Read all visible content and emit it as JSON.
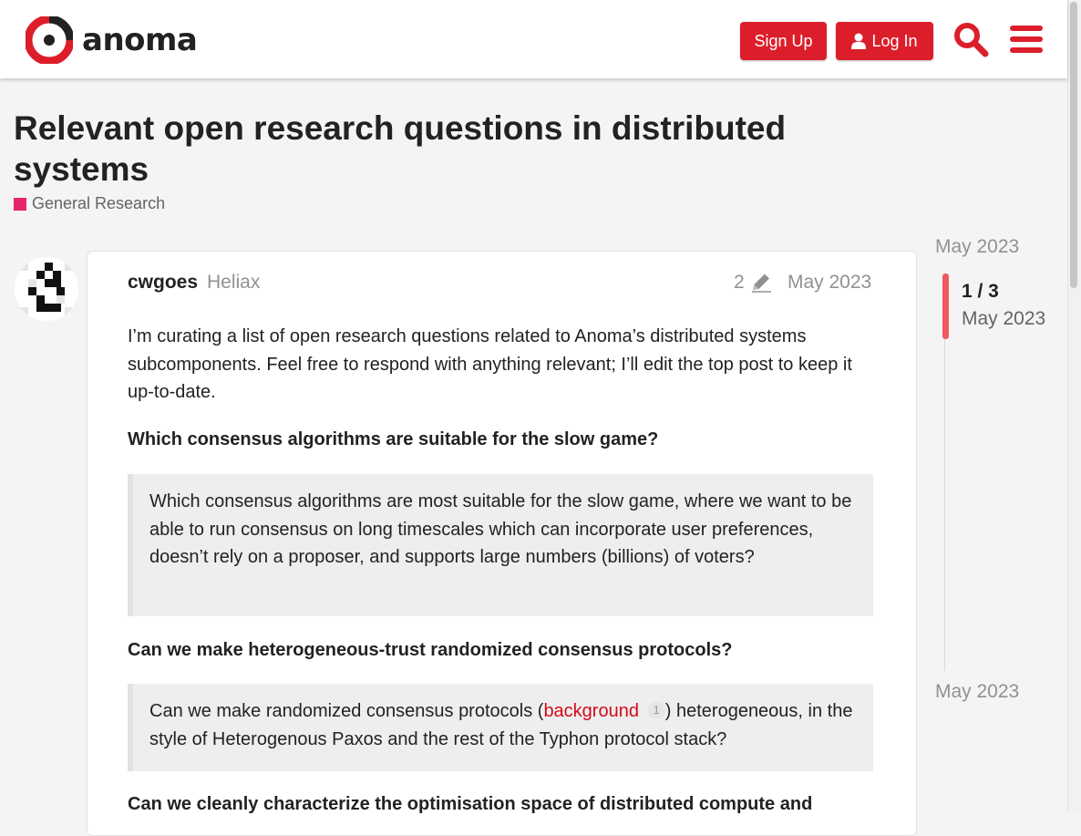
{
  "header": {
    "logo_text": "anoma",
    "logo_icon": "anoma-logo-icon",
    "signup_label": "Sign Up",
    "login_label": "Log In",
    "login_icon": "user-icon",
    "search_icon": "search-icon",
    "menu_icon": "hamburger-menu-icon",
    "accent_color": "#dc1e2b"
  },
  "topic": {
    "title": "Relevant open research questions in distributed systems",
    "category": "General Research",
    "category_color": "#e7246a"
  },
  "post": {
    "username": "cwgoes",
    "user_title": "Heliax",
    "edit_count": "2",
    "edit_icon": "pencil-icon",
    "date": "May 2023",
    "intro": "I’m curating a list of open research questions related to Anoma’s distributed systems subcomponents. Feel free to respond with anything relevant; I’ll edit the top post to keep it up-to-date.",
    "section1_heading": "Which consensus algorithms are suitable for the slow game?",
    "section1_quote": "Which consensus algorithms are most suitable for the slow game, where we want to be able to run consensus on long timescales which can incorporate user preferences, doesn’t rely on a proposer, and supports large numbers (billions) of voters?",
    "section2_heading": "Can we make heterogeneous-trust randomized consensus protocols?",
    "section2_quote_before": "Can we make randomized consensus protocols (",
    "section2_link": "background",
    "section2_link_clicks": "1",
    "section2_quote_after": ") heterogeneous, in the style of Heterogenous Paxos and the rest of the Typhon protocol stack?",
    "section3_heading": "Can we cleanly characterize the optimisation space of distributed compute and"
  },
  "timeline": {
    "start_date": "May 2023",
    "position": "1 / 3",
    "current_date": "May 2023",
    "end_date": "May 2023",
    "handle_color": "#f0575f"
  }
}
